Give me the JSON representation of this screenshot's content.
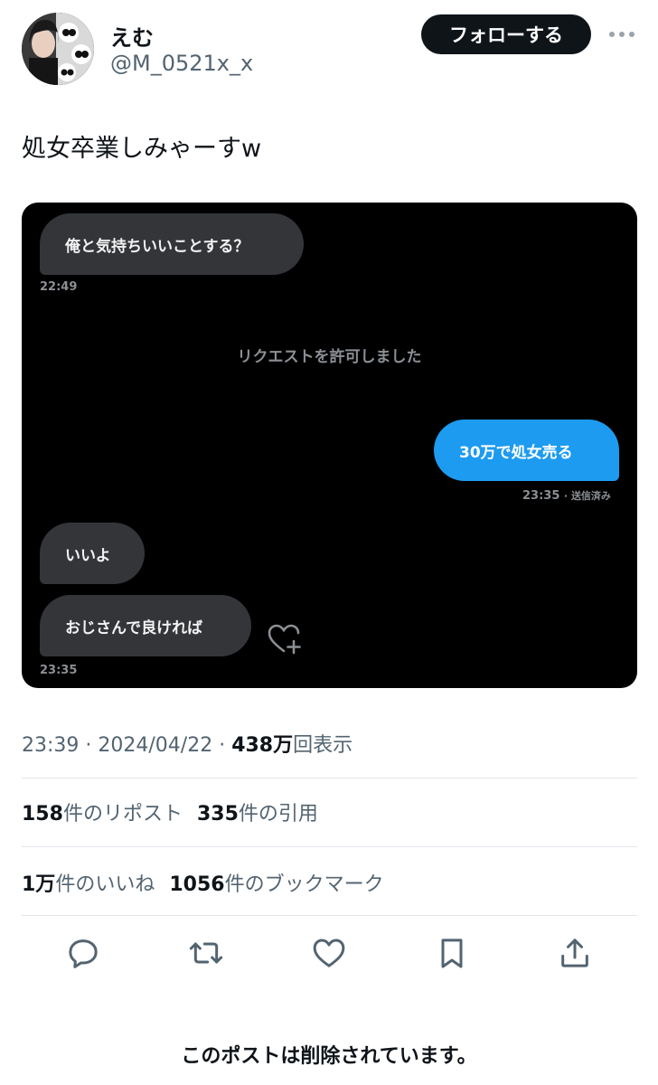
{
  "author": {
    "display_name": "えむ",
    "handle": "@M_0521x_x",
    "follow_label": "フォローする"
  },
  "tweet": {
    "text": "処女卒業しみゃーすw"
  },
  "media": {
    "messages": [
      {
        "side": "left",
        "text": "俺と気持ちいいことする？",
        "time": "22:49"
      },
      {
        "side": "system",
        "text": "リクエストを許可しました"
      },
      {
        "side": "right",
        "text": "30万で処女売る",
        "time": "23:35",
        "status": "送信済み"
      },
      {
        "side": "left",
        "text": "いいよ"
      },
      {
        "side": "left",
        "text": "おじさんで良ければ",
        "time": "23:35"
      }
    ]
  },
  "meta": {
    "time": "23:39",
    "date": "2024/04/22",
    "views": "438万",
    "views_label": "回表示"
  },
  "stats": {
    "reposts": "158",
    "reposts_label": "件のリポスト",
    "quotes": "335",
    "quotes_label": "件の引用",
    "likes": "1万",
    "likes_label": "件のいいね",
    "bookmarks": "1056",
    "bookmarks_label": "件のブックマーク"
  },
  "notice": "このポストは削除されています。",
  "icons": [
    "more-icon",
    "reply-icon",
    "repost-icon",
    "like-icon",
    "bookmark-icon",
    "share-icon",
    "heart-plus-icon"
  ],
  "colors": {
    "accent": "#1d9bf0",
    "text": "#0f1419",
    "muted": "#536471"
  }
}
